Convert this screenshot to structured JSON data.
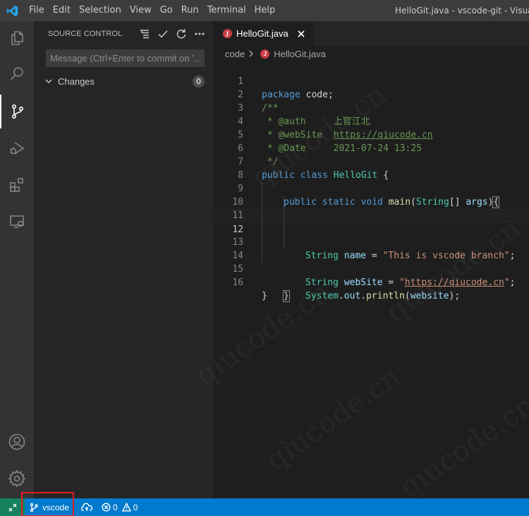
{
  "window": {
    "title": "HelloGit.java - vscode-git - Visual Studio Code"
  },
  "menu": [
    "File",
    "Edit",
    "Selection",
    "View",
    "Go",
    "Run",
    "Terminal",
    "Help"
  ],
  "activity_bar": {
    "items": [
      "files-icon",
      "search-icon",
      "source-control-icon",
      "run-debug-icon",
      "extensions-icon",
      "remote-explorer-icon"
    ],
    "bottom": [
      "account-icon",
      "settings-gear-icon"
    ],
    "active": "source-control-icon"
  },
  "sidebar": {
    "title": "SOURCE CONTROL",
    "actions": [
      "view-as-tree-icon",
      "commit-check-icon",
      "refresh-icon",
      "more-actions-icon"
    ],
    "commit_placeholder": "Message (Ctrl+Enter to commit on '...",
    "changes_label": "Changes",
    "changes_count": "0"
  },
  "editor": {
    "tab_label": "HelloGit.java",
    "tab_icon_letter": "J",
    "breadcrumb": [
      "code",
      "HelloGit.java"
    ],
    "current_line": 12,
    "lines": [
      {
        "n": "1"
      },
      {
        "n": "2"
      },
      {
        "n": "3"
      },
      {
        "n": "4"
      },
      {
        "n": "5"
      },
      {
        "n": "6"
      },
      {
        "n": "7"
      },
      {
        "n": "8"
      },
      {
        "n": "9"
      },
      {
        "n": "10"
      },
      {
        "n": "11"
      },
      {
        "n": "12"
      },
      {
        "n": "13"
      },
      {
        "n": "14"
      },
      {
        "n": "15"
      },
      {
        "n": "16"
      }
    ],
    "code": {
      "l1_kw": "package",
      "l1_rest": " code;",
      "l2": "/**",
      "l3_tag": " * @auth     ",
      "l3_val": "上官江北",
      "l4_tag": " * @webSite  ",
      "l4_val": "https://qiucode.cn",
      "l5_tag": " * @Date     ",
      "l5_val": "2021-07-24 13:25",
      "l6": " */",
      "l7_kw": "public class ",
      "l7_name": "HelloGit",
      "l7_rest": " {",
      "l9_kw1": "public static void ",
      "l9_fn": "main",
      "l9_p1": "(",
      "l9_ty": "String",
      "l9_p2": "[] ",
      "l9_var": "args",
      "l9_p3": ")",
      "l9_brace": "{",
      "l11_ty": "String ",
      "l11_var": "name",
      "l11_eq": " = ",
      "l11_str": "\"This is vscode branch\"",
      "l11_end": ";",
      "l13_ty": "String ",
      "l13_var": "webSite",
      "l13_eq": " = ",
      "l13_q1": "\"",
      "l13_url": "https://qiucode.cn",
      "l13_q2": "\"",
      "l13_end": ";",
      "l14_obj": "System",
      "l14_dot1": ".",
      "l14_field": "out",
      "l14_dot2": ".",
      "l14_fn": "println",
      "l14_p1": "(",
      "l14_arg": "website",
      "l14_p2": ");",
      "l15": "}",
      "l16": "}"
    },
    "watermark": "qiucode.cn"
  },
  "statusbar": {
    "branch": "vscode",
    "errors": "0",
    "warnings": "0"
  },
  "colors": {
    "statusbar": "#007acc",
    "remote": "#16825d",
    "highlight_box": "#e51c23",
    "java_icon": "#cc3e44"
  }
}
